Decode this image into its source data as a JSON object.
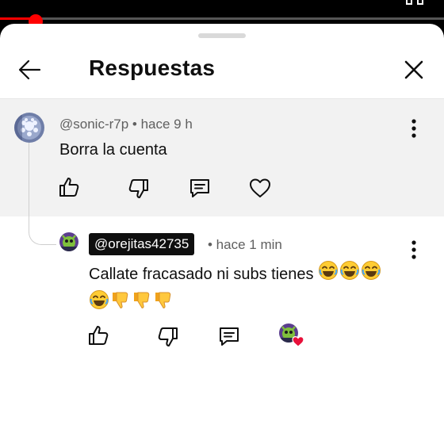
{
  "video_progress": 0.08,
  "sheet": {
    "title": "Respuestas",
    "back_icon": "arrow-left-icon",
    "close_icon": "close-icon"
  },
  "parent_comment": {
    "author": "@sonic-r7p",
    "time": "hace 9 h",
    "meta": "@sonic-r7p • hace 9 h",
    "text": "Borra la cuenta",
    "actions": [
      "like-icon",
      "dislike-icon",
      "reply-icon",
      "heart-outline-icon"
    ]
  },
  "reply": {
    "author": "@orejitas42735",
    "time": "• hace 1 min",
    "text_line1": "Callate fracasado ni subs tienes",
    "text_line2_emojis": [
      "😂",
      "👎",
      "👎",
      "👎"
    ],
    "line1_emojis": [
      "😂",
      "😂",
      "😂"
    ],
    "actions": [
      "like-icon",
      "dislike-icon",
      "reply-icon",
      "creator-heart-icon"
    ]
  },
  "colors": {
    "accent": "#ff0000",
    "heart": "#e8103a",
    "meta_text": "#606060",
    "parent_bg": "#f2f2f2"
  }
}
